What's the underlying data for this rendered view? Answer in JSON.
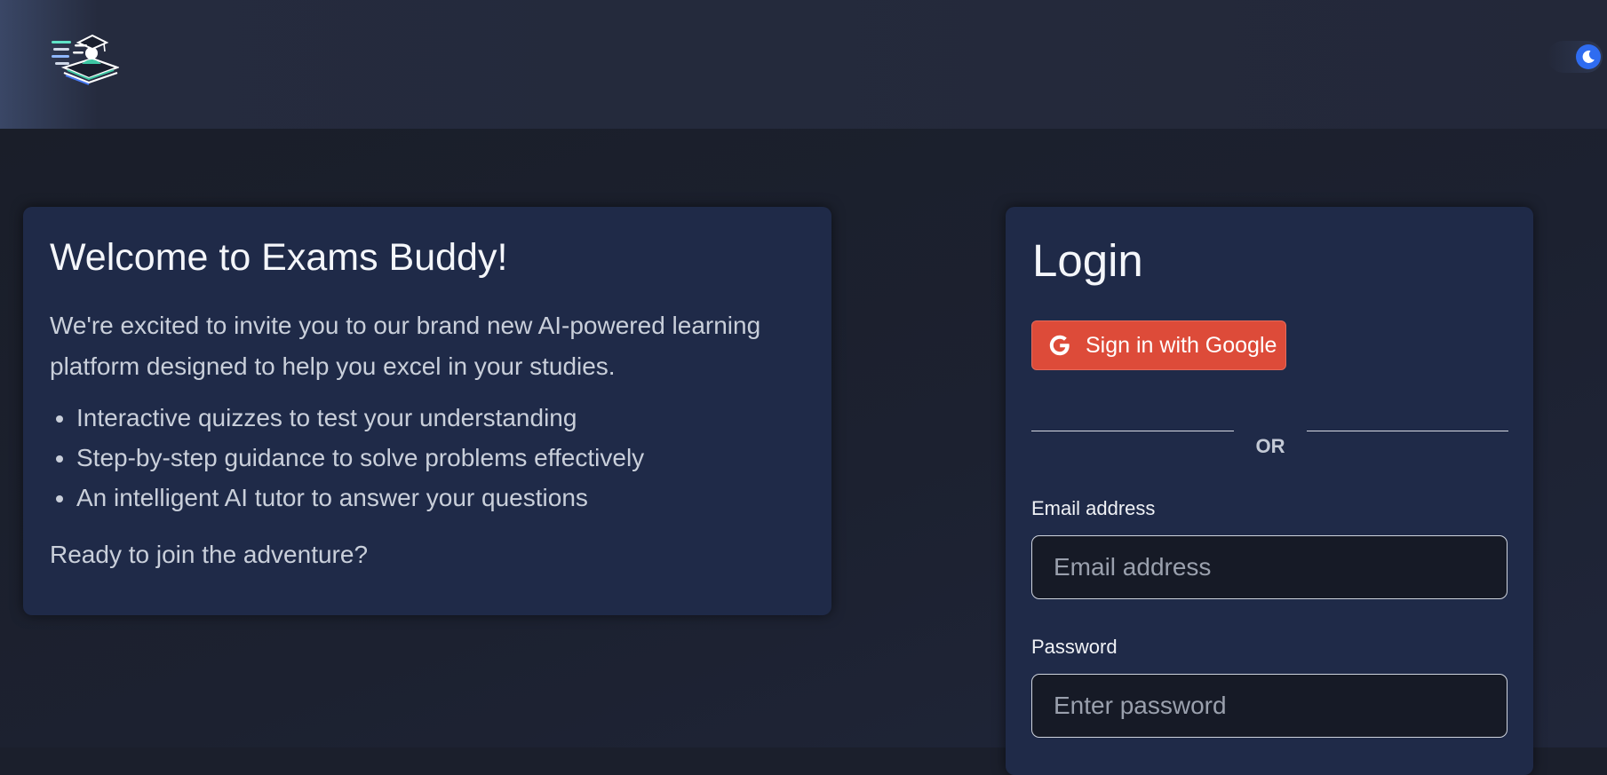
{
  "header": {
    "logo_icon": "graduation-book-logo",
    "theme_toggle_icon": "moon-icon"
  },
  "welcome": {
    "title": "Welcome to Exams Buddy!",
    "intro": "We're excited to invite you to our brand new AI-powered learning platform designed to help you excel in your studies.",
    "features": [
      "Interactive quizzes to test your understanding",
      "Step-by-step guidance to solve problems effectively",
      "An intelligent AI tutor to answer your questions"
    ],
    "cta": "Ready to join the adventure?"
  },
  "login": {
    "title": "Login",
    "google_button": "Sign in with Google",
    "divider": "OR",
    "email_label": "Email address",
    "email_placeholder": "Email address",
    "email_value": "",
    "password_label": "Password",
    "password_placeholder": "Enter password",
    "password_value": ""
  },
  "colors": {
    "background": "#1b1f2c",
    "card": "#1f2a48",
    "google_red": "#dd4b39",
    "toggle_blue": "#2f6cf0"
  }
}
